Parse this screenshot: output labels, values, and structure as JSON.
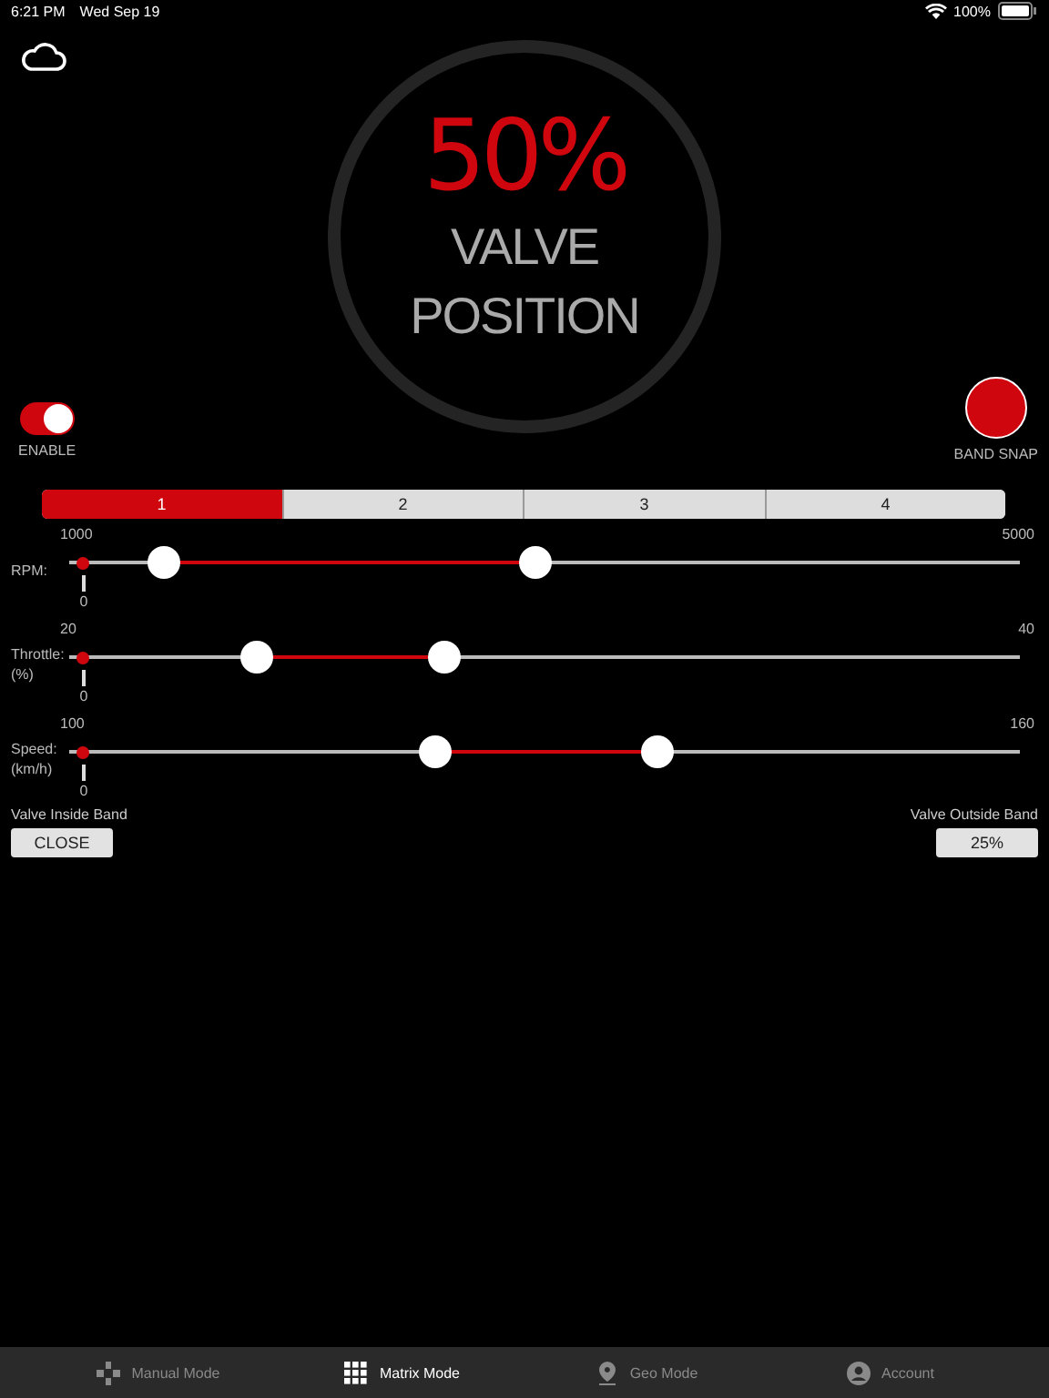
{
  "status_bar": {
    "time": "6:21 PM",
    "date": "Wed Sep 19",
    "battery": "100%"
  },
  "gauge": {
    "value": "50%",
    "label_line_1": "VALVE",
    "label_line_2": "POSITION"
  },
  "enable": {
    "label": "ENABLE",
    "on": true
  },
  "band_snap": {
    "label": "BAND SNAP",
    "on": true
  },
  "bands": [
    {
      "label": "1",
      "selected": true
    },
    {
      "label": "2",
      "selected": false
    },
    {
      "label": "3",
      "selected": false
    },
    {
      "label": "4",
      "selected": false
    }
  ],
  "sliders": [
    {
      "label": "RPM:",
      "min": "1000",
      "max": "5000",
      "zero": "0",
      "low": {
        "level": 0.099
      },
      "high": {
        "level": 0.49
      }
    },
    {
      "label": "Throttle:\n(%)",
      "min": "20",
      "max": "40",
      "zero": "0",
      "low": {
        "level": 0.197
      },
      "high": {
        "level": 0.395
      }
    },
    {
      "label": "Speed:\n(km/h)",
      "min": "100",
      "max": "160",
      "zero": "0",
      "low": {
        "level": 0.385
      },
      "high": {
        "level": 0.619
      }
    }
  ],
  "valve_inside": {
    "label": "Valve Inside Band",
    "button": "CLOSE"
  },
  "valve_outside": {
    "label": "Valve Outside Band",
    "button": "25%"
  },
  "tab_bar": [
    {
      "kind": "gamepad",
      "label": "Manual Mode",
      "selected": false
    },
    {
      "kind": "grid",
      "label": "Matrix Mode",
      "selected": true
    },
    {
      "kind": "pin",
      "label": "Geo Mode",
      "selected": false
    },
    {
      "kind": "account",
      "label": "Account",
      "selected": false
    }
  ]
}
